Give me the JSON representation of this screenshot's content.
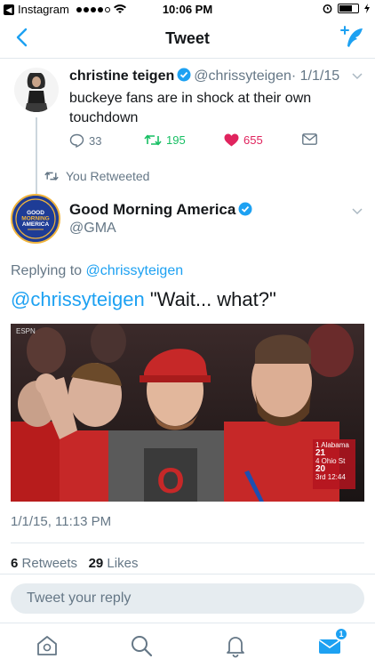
{
  "status_bar": {
    "app": "Instagram",
    "time": "10:06 PM"
  },
  "nav": {
    "title": "Tweet"
  },
  "parent_tweet": {
    "name": "christine teigen",
    "handle": "@chrissyteigen",
    "date": "· 1/1/15",
    "text": "buckeye fans are in shock at their own touchdown",
    "replies": "33",
    "retweets": "195",
    "likes": "655"
  },
  "retweeted_label": "You Retweeted",
  "main_tweet": {
    "avatar_text": [
      "GOOD",
      "MORNING",
      "AMERICA"
    ],
    "name": "Good Morning America",
    "handle": "@GMA",
    "replying_prefix": "Replying to",
    "replying_to": "@chrissyteigen",
    "text_mention": "@chrissyteigen",
    "text_body": " \"Wait... what?\"",
    "timestamp": "1/1/15, 11:13 PM",
    "retweets_count": "6",
    "retweets_label": "Retweets",
    "likes_count": "29",
    "likes_label": "Likes"
  },
  "media": {
    "network": "ESPN",
    "scoreboard": {
      "team1": "1 Alabama",
      "score1": "21",
      "team2": "4 Ohio St",
      "score2": "20",
      "clock": "3rd 12:44"
    }
  },
  "reply_placeholder": "Tweet your reply",
  "tab_bar": {
    "badge": "1"
  },
  "colors": {
    "accent": "#1da1f2",
    "retweet": "#17bf63",
    "like": "#e0245e",
    "muted": "#657786"
  }
}
